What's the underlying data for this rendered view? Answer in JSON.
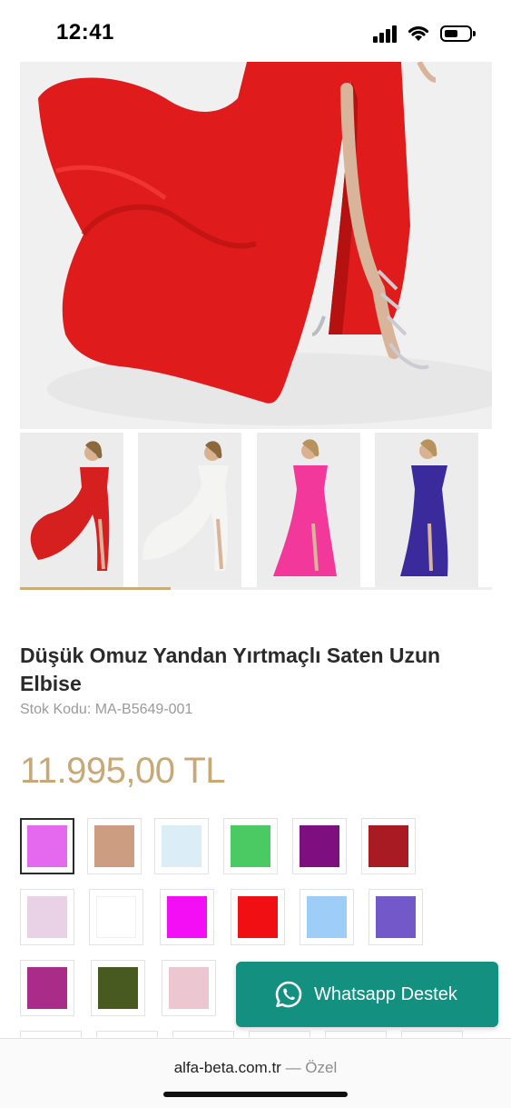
{
  "status_bar": {
    "time": "12:41"
  },
  "product": {
    "title": "Düşük Omuz Yandan Yırtmaçlı Saten Uzun Elbise",
    "sku": "Stok Kodu: MA-B5649-001",
    "price": "11.995,00 TL",
    "gallery_progress": 0.32,
    "thumbnails": [
      {
        "dress_color": "#d61f1f"
      },
      {
        "dress_color": "#f4f4f2"
      },
      {
        "dress_color": "#f2389a"
      },
      {
        "dress_color": "#3a2a9c"
      }
    ],
    "hero_dress_color": "#e01b1b"
  },
  "color_swatches": [
    "#e469ee",
    "#cc9d80",
    "#dbeef7",
    "#4bc962",
    "#7e0f7e",
    "#a81b22",
    "#ead2e6",
    "#ffffff",
    "#f30ef6",
    "#f00f12",
    "#9ecef8",
    "#7258c8",
    "#a82c88",
    "#485a20",
    "#ecc6d0"
  ],
  "whatsapp": {
    "label": "Whatsapp Destek"
  },
  "browser": {
    "domain": "alfa-beta.com.tr",
    "separator": "—",
    "mode": "Özel"
  }
}
